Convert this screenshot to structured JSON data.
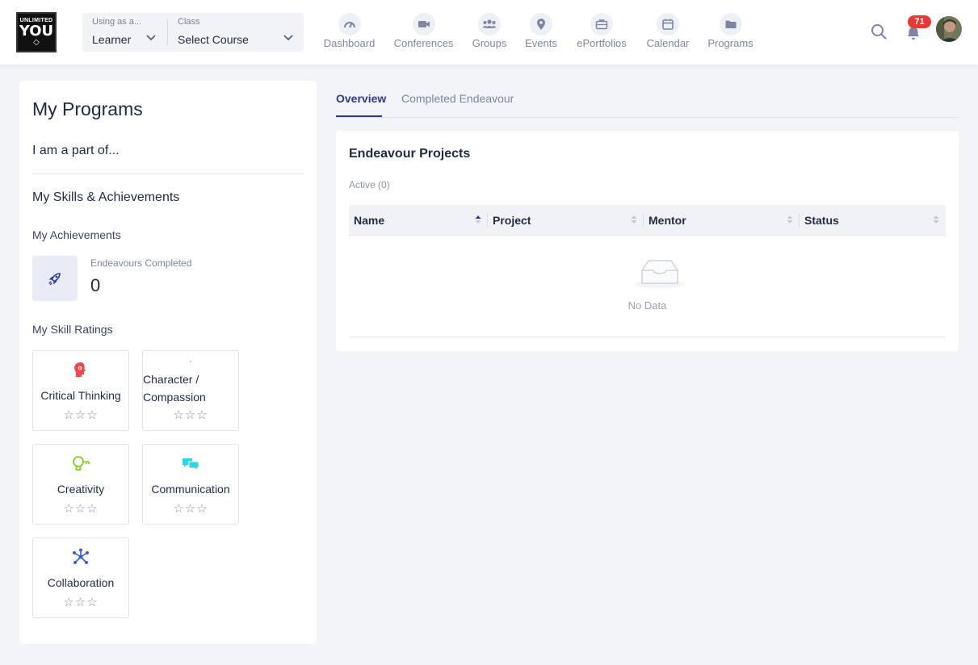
{
  "logo": {
    "line1": "UNLIMITED",
    "line2": "YOU",
    "line3": "◇"
  },
  "selectors": {
    "using_as": {
      "caption": "Using as a...",
      "value": "Learner"
    },
    "class": {
      "caption": "Class",
      "value": "Select Course"
    }
  },
  "nav": [
    {
      "label": "Dashboard",
      "icon": "gauge-icon"
    },
    {
      "label": "Conferences",
      "icon": "video-icon"
    },
    {
      "label": "Groups",
      "icon": "users-icon"
    },
    {
      "label": "Events",
      "icon": "map-pin-icon"
    },
    {
      "label": "ePortfolios",
      "icon": "briefcase-icon"
    },
    {
      "label": "Calendar",
      "icon": "calendar-icon"
    },
    {
      "label": "Programs",
      "icon": "folder-icon"
    }
  ],
  "header_right": {
    "notification_count": "71"
  },
  "left_panel": {
    "title": "My Programs",
    "part_of": "I am a part of...",
    "skills_heading": "My Skills & Achievements",
    "achievements_heading": "My Achievements",
    "achievement": {
      "label": "Endeavours Completed",
      "value": "0"
    },
    "ratings_heading": "My Skill Ratings",
    "skills": [
      {
        "name": "Critical Thinking",
        "stars": "☆☆☆",
        "icon": "brain-gear-icon",
        "color": "#f0484e"
      },
      {
        "name": "Character / Compassion",
        "stars": "☆☆☆",
        "icon": "heart-icon",
        "color": "#f6c12b"
      },
      {
        "name": "Creativity",
        "stars": "☆☆☆",
        "icon": "lightbulb-icon",
        "color": "#7ed321"
      },
      {
        "name": "Communication",
        "stars": "☆☆☆",
        "icon": "chat-bubbles-icon",
        "color": "#2fd4e6"
      },
      {
        "name": "Collaboration",
        "stars": "☆☆☆",
        "icon": "network-icon",
        "color": "#3b5bdb"
      }
    ]
  },
  "tabs": [
    {
      "label": "Overview",
      "active": true
    },
    {
      "label": "Completed Endeavour",
      "active": false
    }
  ],
  "projects": {
    "title": "Endeavour Projects",
    "active_label": "Active (0)",
    "columns": [
      "Name",
      "Project",
      "Mentor",
      "Status"
    ],
    "empty_text": "No Data"
  },
  "colors": {
    "accent": "#2d3a8c",
    "badge": "#e53935",
    "background": "#f2f4f8"
  }
}
